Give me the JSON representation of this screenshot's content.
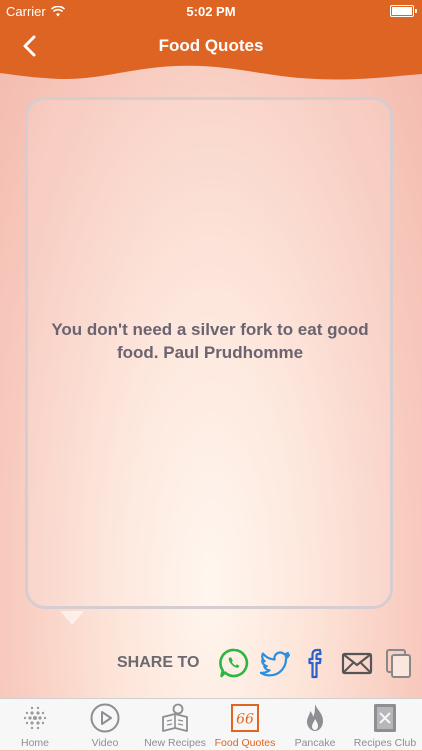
{
  "status_bar": {
    "carrier": "Carrier",
    "time": "5:02 PM"
  },
  "header": {
    "title": "Food Quotes",
    "back_icon": "chevron-left-icon",
    "color": "#e0651f"
  },
  "quote": {
    "text": "You don't need a silver fork to eat good food. Paul Prudhomme"
  },
  "share": {
    "label": "SHARE TO",
    "targets": [
      {
        "name": "whatsapp",
        "icon": "whatsapp-icon",
        "color": "#2bb741"
      },
      {
        "name": "twitter",
        "icon": "twitter-icon",
        "color": "#2a8fe0"
      },
      {
        "name": "facebook",
        "icon": "facebook-icon",
        "color": "#2a62c9"
      },
      {
        "name": "email",
        "icon": "mail-icon",
        "color": "#5a5a5a"
      },
      {
        "name": "copy",
        "icon": "copy-icon",
        "color": "#8a8a8a"
      }
    ]
  },
  "tabs": [
    {
      "label": "Home",
      "icon": "grid-dots-icon"
    },
    {
      "label": "Video",
      "icon": "play-circle-icon"
    },
    {
      "label": "New Recipes",
      "icon": "recipe-book-icon"
    },
    {
      "label": "Food Quotes",
      "icon": "quote-66-icon",
      "active": true,
      "glyph": "66"
    },
    {
      "label": "Pancake",
      "icon": "flame-icon"
    },
    {
      "label": "Recipes Club",
      "icon": "club-book-icon"
    }
  ]
}
